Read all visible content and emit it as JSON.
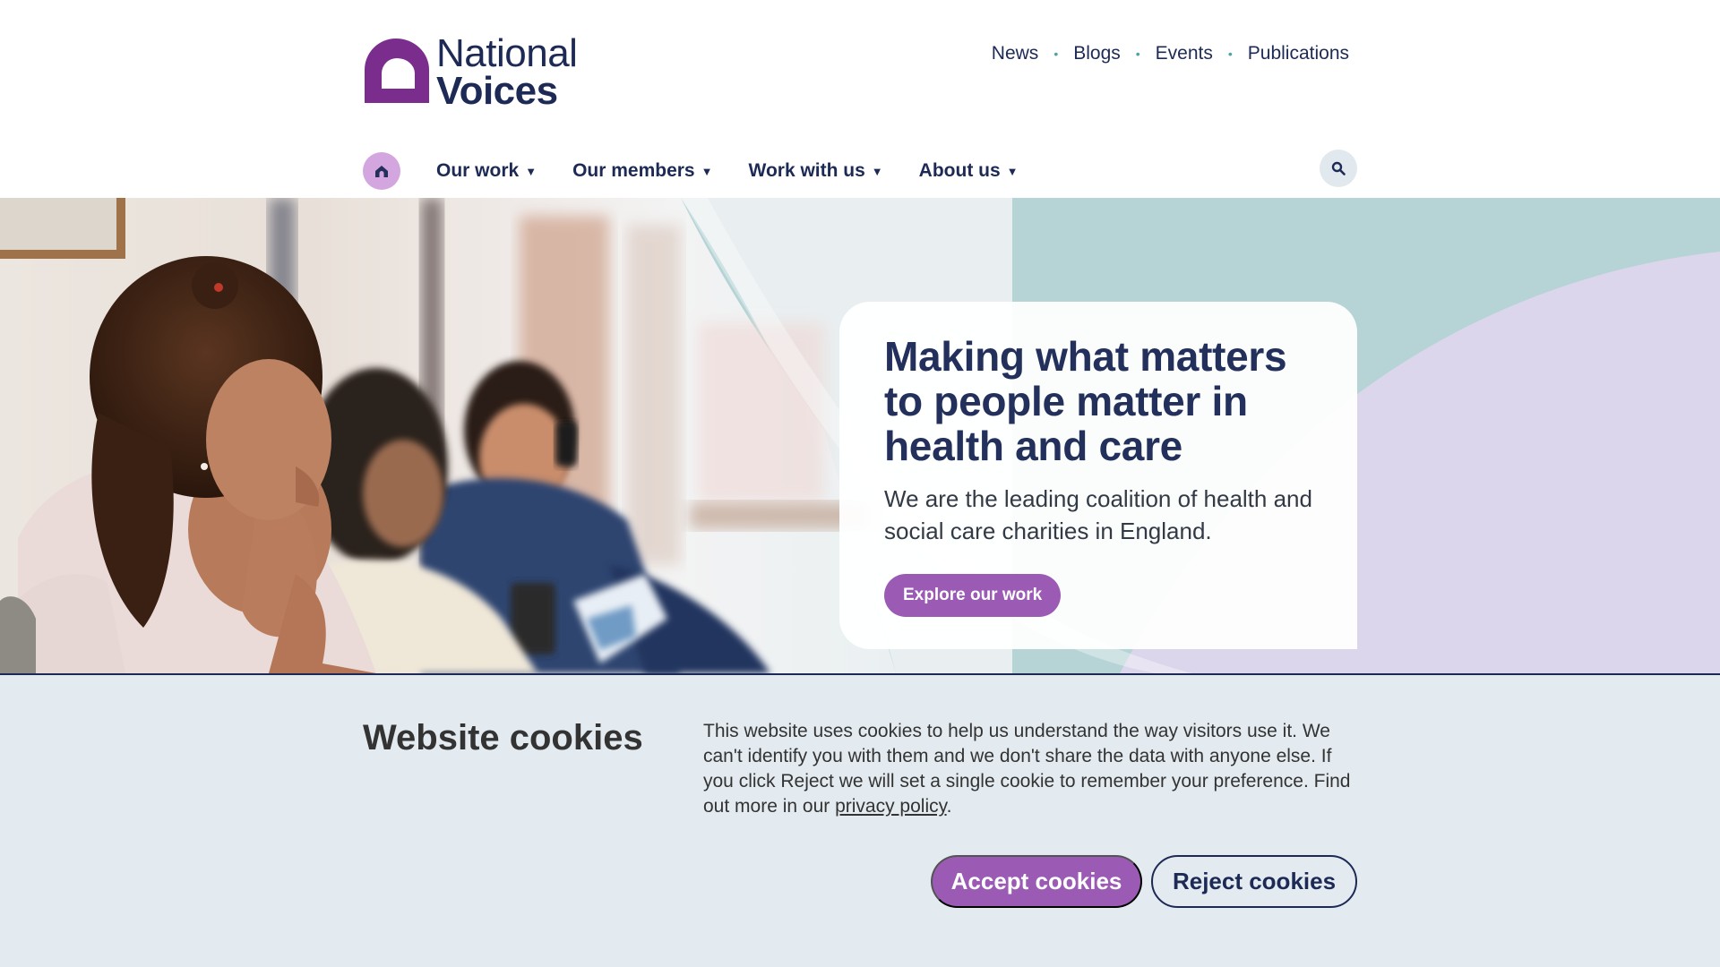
{
  "brand": {
    "name_line1": "National",
    "name_line2": "Voices",
    "purple": "#7b2d8e",
    "navy": "#1d2a55"
  },
  "top_links": [
    {
      "label": "News"
    },
    {
      "label": "Blogs"
    },
    {
      "label": "Events"
    },
    {
      "label": "Publications"
    }
  ],
  "nav": {
    "home_icon": "home-icon",
    "items": [
      {
        "label": "Our work"
      },
      {
        "label": "Our members"
      },
      {
        "label": "Work with us"
      },
      {
        "label": "About us"
      }
    ],
    "caret": "▼",
    "search_icon": "search-icon"
  },
  "hero": {
    "title": "Making what matters to people matter in health and care",
    "subtitle": "We are the leading coalition of health and social care charities in England.",
    "button": "Explore our work"
  },
  "cookies": {
    "title": "Website cookies",
    "text_before_link": "This website uses cookies to help us understand the way visitors use it. We can't identify you with them and we don't share the data with anyone else. If you click Reject we will set a single cookie to remember your preference. Find out more in our ",
    "link": "privacy policy",
    "text_after_link": ".",
    "accept": "Accept cookies",
    "reject": "Reject cookies",
    "accent": "#9b5bb5"
  }
}
